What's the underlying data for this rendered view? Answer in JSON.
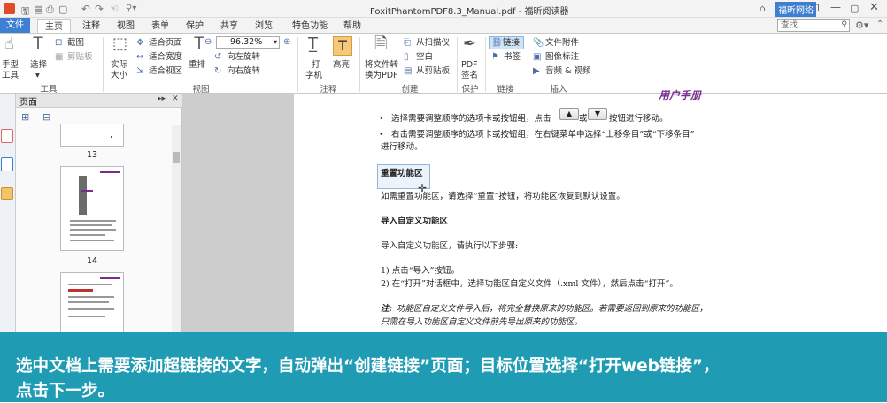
{
  "window": {
    "title": "FoxitPhantomPDF8.3_Manual.pdf - 福昕阅读器",
    "account_label": "福昕网络"
  },
  "tabs": [
    {
      "label": "文件"
    },
    {
      "label": "主页"
    },
    {
      "label": "注释"
    },
    {
      "label": "视图"
    },
    {
      "label": "表单"
    },
    {
      "label": "保护"
    },
    {
      "label": "共享"
    },
    {
      "label": "浏览"
    },
    {
      "label": "特色功能"
    },
    {
      "label": "帮助"
    }
  ],
  "search": {
    "placeholder": "查找"
  },
  "ribbon": {
    "hand_tool_1": "手型",
    "hand_tool_2": "工具",
    "select_1": "选择",
    "snapshot": "截图",
    "clipboard": "剪贴板",
    "tools_group": "工具",
    "actual_size_1": "实际",
    "actual_size_2": "大小",
    "fit_page": "适合页面",
    "fit_width": "适合宽度",
    "fit_visible": "适合视区",
    "reflow": "重排",
    "zoom_value": "96.32%",
    "rotate_left": "向左旋转",
    "rotate_right": "向右旋转",
    "view_group": "视图",
    "typewriter_1": "打",
    "typewriter_2": "字机",
    "highlight": "高亮",
    "comment_group": "注释",
    "convert_1": "将文件转",
    "convert_2": "换为PDF",
    "from_scanner": "从扫描仪",
    "blank": "空白",
    "from_clipboard": "从剪贴板",
    "create_group": "创建",
    "pdf_sign_1": "PDF",
    "pdf_sign_2": "签名",
    "protect_group": "保护",
    "link": "链接",
    "bookmark": "书签",
    "link_group": "链接",
    "file_attachment": "文件附件",
    "image_annotation": "图像标注",
    "audio_video": "音频 & 视频",
    "insert_group": "插入"
  },
  "panel": {
    "title": "页面",
    "page_numbers": [
      "13",
      "14"
    ]
  },
  "document": {
    "header_fragment": "用户手册",
    "bullet1_a": "选择需要调整顺序的选项卡或按钮组，点击",
    "bullet1_b": "或",
    "bullet1_c": "按钮进行移动。",
    "up_arrow": "▲",
    "down_arrow": "▼",
    "bullet2_line1": "右击需要调整顺序的选项卡或按钮组，在右键菜单中选择“上移条目”或“下移条目”",
    "bullet2_line2": "进行移动。",
    "heading_reset": "重置功能区",
    "reset_text": "如需重置功能区，请选择“重置”按钮，将功能区恢复到默认设置。",
    "heading_import": "导入自定义功能区",
    "import_intro": "导入自定义功能区，请执行以下步骤:",
    "step1": "1)  点击“导入”按钮。",
    "step2": "2)  在“打开”对话框中，选择功能区自定义文件（.xml 文件），然后点击“打开”。",
    "note_label": "注:",
    "note_line1": "功能区自定义文件导入后，将完全替换原来的功能区。若需要返回到原来的功能区，",
    "note_line2": "只需在导入功能区自定义文件前先导出原来的功能区。"
  },
  "caption": {
    "line1": "选中文档上需要添加超链接的文字，自动弹出“创建链接”页面；目标位置选择“打开web链接”，",
    "line2": "点击下一步。"
  },
  "colors": {
    "accent": "#3d7fd1",
    "caption_bg": "#1f9bb4",
    "highlight_tool": "#f5c97b"
  }
}
